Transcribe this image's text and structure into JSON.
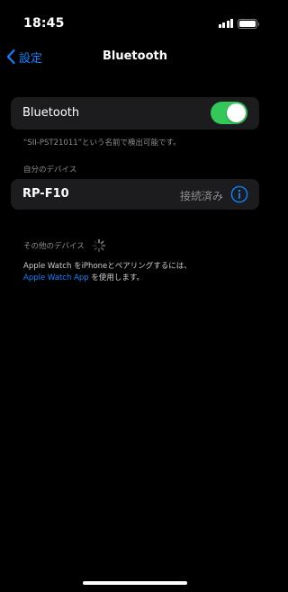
{
  "status_bar": {
    "time": "18:45",
    "icons": [
      "signal-icon",
      "battery-icon"
    ]
  },
  "nav": {
    "back_label": "設定",
    "title": "Bluetooth"
  },
  "bluetooth": {
    "label": "Bluetooth",
    "enabled": true,
    "discoverable_note": "“SII-PST21011”という名前で検出可能です。"
  },
  "my_devices": {
    "header": "自分のデバイス",
    "items": [
      {
        "name": "RP-F10",
        "status": "接続済み",
        "icon": "info-icon"
      }
    ]
  },
  "other_devices": {
    "header": "その他のデバイス",
    "watch_note_line1": "Apple Watch をiPhoneとペアリングするには、",
    "watch_link": "Apple Watch App",
    "watch_note_line2_suffix": "を使用します。"
  },
  "colors": {
    "accent": "#0a84ff",
    "toggle_on": "#34c759",
    "background": "#000000",
    "cell": "#1c1c1e",
    "secondary_text": "#8d8d93"
  }
}
